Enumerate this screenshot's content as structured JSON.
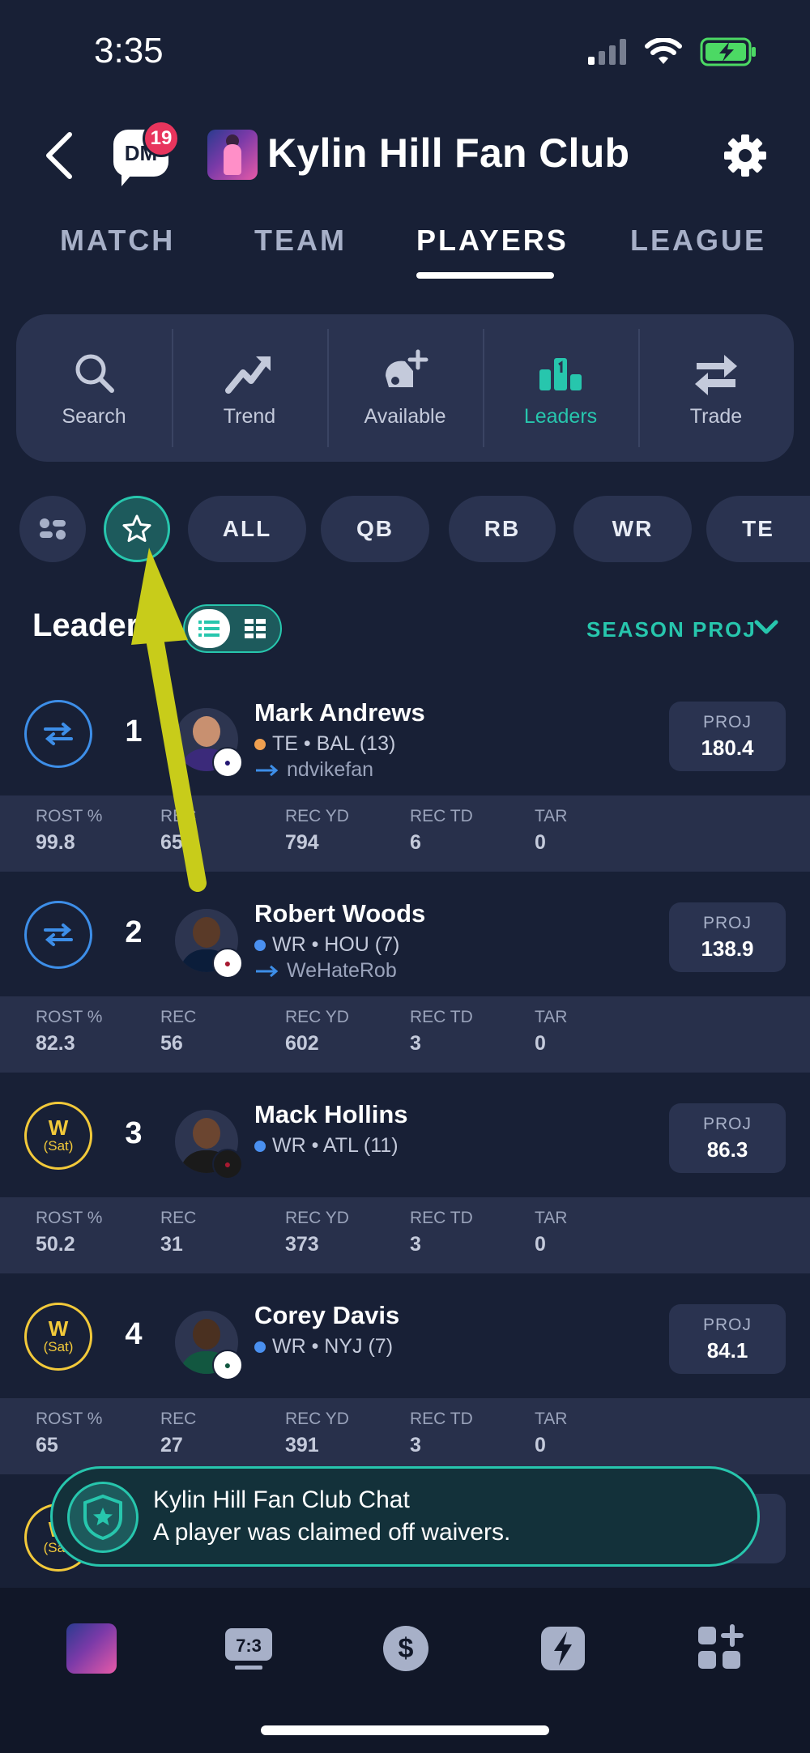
{
  "status_bar": {
    "time": "3:35"
  },
  "header": {
    "dm_label": "DM",
    "dm_badge": "19",
    "title": "Kylin Hill Fan Club"
  },
  "tabs": [
    {
      "label": "MATCH"
    },
    {
      "label": "TEAM"
    },
    {
      "label": "PLAYERS",
      "active": true
    },
    {
      "label": "LEAGUE"
    }
  ],
  "actions": [
    {
      "label": "Search",
      "icon": "search-icon"
    },
    {
      "label": "Trend",
      "icon": "trend-icon"
    },
    {
      "label": "Available",
      "icon": "available-icon"
    },
    {
      "label": "Leaders",
      "icon": "leaders-icon",
      "active": true
    },
    {
      "label": "Trade",
      "icon": "trade-icon"
    }
  ],
  "chips": [
    {
      "label": "ALL"
    },
    {
      "label": "QB"
    },
    {
      "label": "RB"
    },
    {
      "label": "WR"
    },
    {
      "label": "TE"
    }
  ],
  "leaders": {
    "title": "Leaders",
    "sort_label": "SEASON PROJ"
  },
  "stat_headers": [
    "ROST %",
    "REC",
    "REC YD",
    "REC TD",
    "TAR"
  ],
  "players": [
    {
      "badge": "trade",
      "rank": "1",
      "name": "Mark Andrews",
      "info": "TE • BAL (13)",
      "pos_color": "#f0a050",
      "owner": "ndvikefan",
      "proj_label": "PROJ",
      "proj": "180.4",
      "stats": [
        "99.8",
        "65",
        "794",
        "6",
        "0"
      ]
    },
    {
      "badge": "trade",
      "rank": "2",
      "name": "Robert Woods",
      "info": "WR • HOU (7)",
      "pos_color": "#4a90f0",
      "owner": "WeHateRob",
      "proj_label": "PROJ",
      "proj": "138.9",
      "stats": [
        "82.3",
        "56",
        "602",
        "3",
        "0"
      ]
    },
    {
      "badge": "waiver",
      "badge_w": "W",
      "badge_sub": "(Sat)",
      "rank": "3",
      "name": "Mack Hollins",
      "info": "WR • ATL (11)",
      "pos_color": "#4a90f0",
      "proj_label": "PROJ",
      "proj": "86.3",
      "stats": [
        "50.2",
        "31",
        "373",
        "3",
        "0"
      ]
    },
    {
      "badge": "waiver",
      "badge_w": "W",
      "badge_sub": "(Sat)",
      "rank": "4",
      "name": "Corey Davis",
      "info": "WR • NYJ (7)",
      "pos_color": "#4a90f0",
      "proj_label": "PROJ",
      "proj": "84.1",
      "stats": [
        "65",
        "27",
        "391",
        "3",
        "0"
      ]
    }
  ],
  "partial_row": {
    "badge_w": "W",
    "badge_sub": "(Sat)"
  },
  "toast": {
    "title": "Kylin Hill Fan Club Chat",
    "message": "A player was claimed off waivers."
  },
  "bottom_nav": [
    {
      "icon": "team-avatar-icon"
    },
    {
      "icon": "scoreboard-icon",
      "label": "7:3"
    },
    {
      "icon": "dollar-icon"
    },
    {
      "icon": "lightning-icon"
    },
    {
      "icon": "more-apps-icon"
    }
  ],
  "colors": {
    "accent": "#27c6ad",
    "background": "#182036",
    "trade": "#3d8ee8",
    "waiver": "#f2c93a"
  }
}
